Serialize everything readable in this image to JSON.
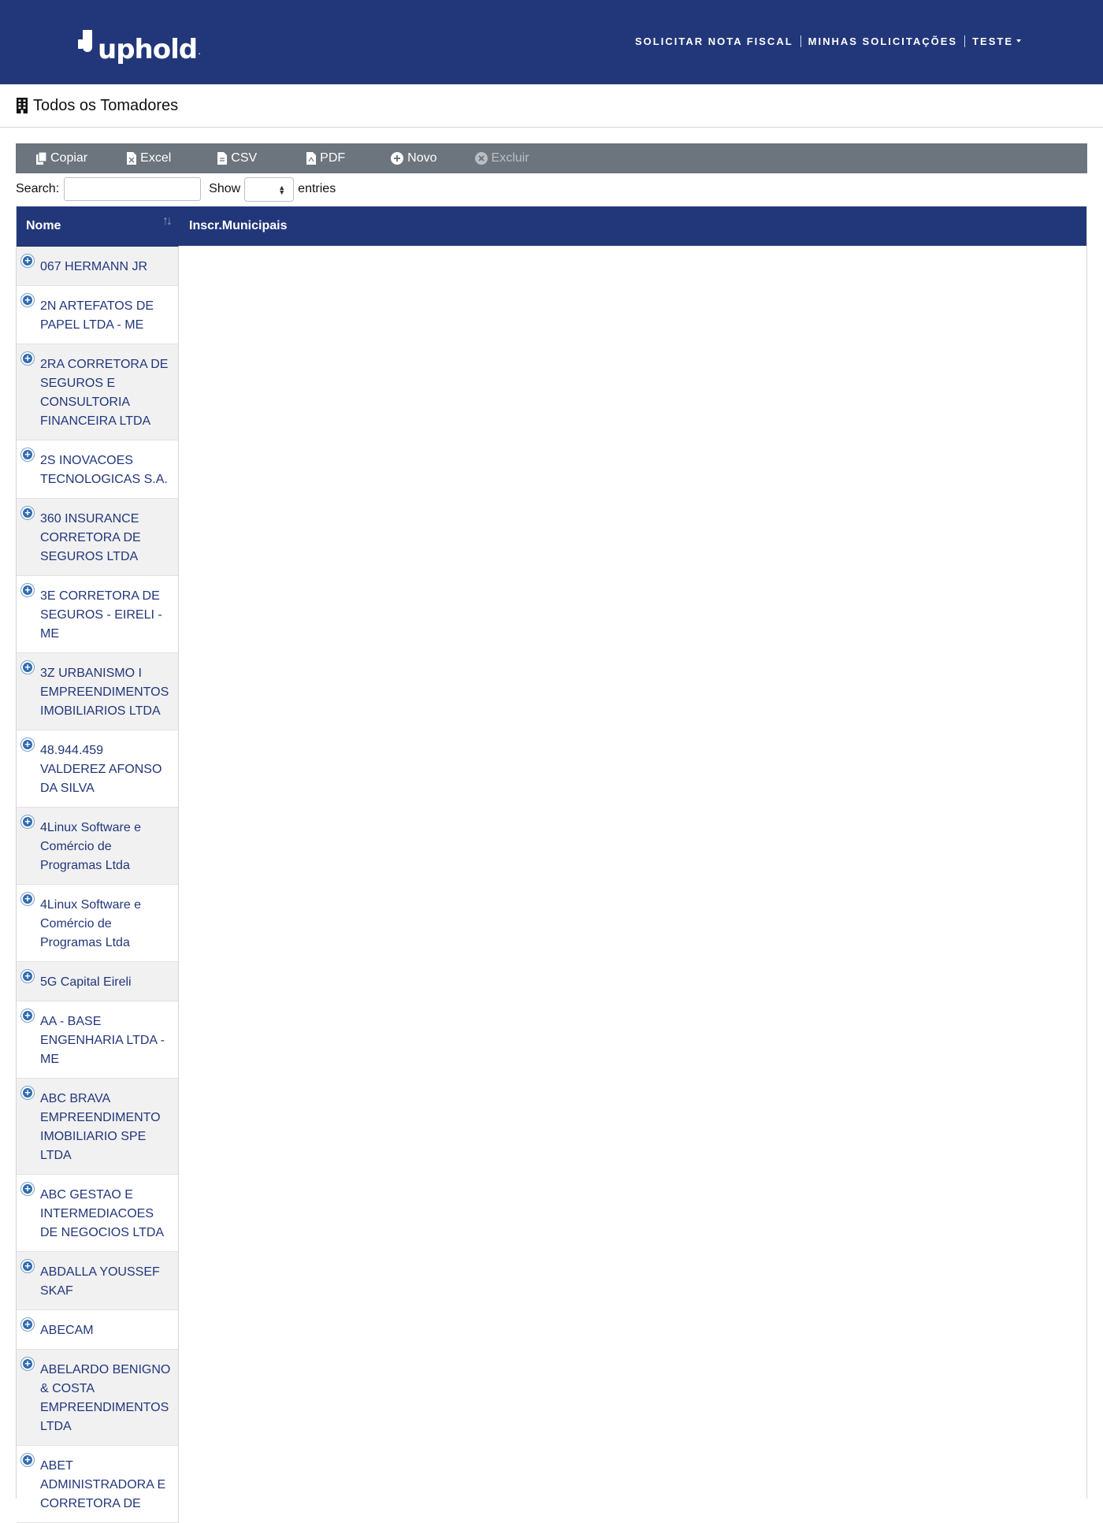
{
  "header": {
    "brand": "uphold",
    "nav": [
      {
        "label": "SOLICITAR NOTA FISCAL"
      },
      {
        "label": "MINHAS SOLICITAÇÕES"
      },
      {
        "label": "TESTE"
      }
    ]
  },
  "page": {
    "title": "Todos os Tomadores",
    "title_icon": "building-icon"
  },
  "toolbar": {
    "buttons": [
      {
        "label": "Copiar",
        "icon": "copy-icon"
      },
      {
        "label": "Excel",
        "icon": "file-excel-icon"
      },
      {
        "label": "CSV",
        "icon": "file-csv-icon"
      },
      {
        "label": "PDF",
        "icon": "file-pdf-icon"
      },
      {
        "label": "Novo",
        "icon": "plus-circle-icon"
      },
      {
        "label": "Excluir",
        "icon": "times-circle-icon",
        "disabled": true
      }
    ]
  },
  "controls": {
    "search_label": "Search:",
    "search_value": "",
    "show_label": "Show",
    "entries_label": "entries",
    "entries_value": ""
  },
  "table": {
    "columns": [
      "Nome",
      "Inscr.Municipais"
    ],
    "rows": [
      "067 HERMANN JR",
      "2N ARTEFATOS DE PAPEL LTDA - ME",
      "2RA CORRETORA DE SEGUROS E CONSULTORIA FINANCEIRA LTDA",
      "2S INOVACOES TECNOLOGICAS S.A.",
      "360 INSURANCE CORRETORA DE SEGUROS LTDA",
      "3E CORRETORA DE SEGUROS - EIRELI - ME",
      "3Z URBANISMO I EMPREENDIMENTOS IMOBILIARIOS LTDA",
      "48.944.459 VALDEREZ AFONSO DA SILVA",
      "4Linux Software e Comércio de Programas Ltda",
      "4Linux Software e Comércio de Programas Ltda",
      "5G Capital Eireli",
      "AA - BASE ENGENHARIA LTDA - ME",
      "ABC BRAVA EMPREENDIMENTO IMOBILIARIO SPE LTDA",
      "ABC GESTAO E INTERMEDIACOES DE NEGOCIOS LTDA",
      "ABDALLA YOUSSEF SKAF",
      "ABECAM",
      "ABELARDO BENIGNO & COSTA EMPREENDIMENTOS LTDA",
      "ABET ADMINISTRADORA E CORRETORA DE"
    ]
  },
  "colors": {
    "navy": "#22377a",
    "toolbar": "#6c757d"
  }
}
